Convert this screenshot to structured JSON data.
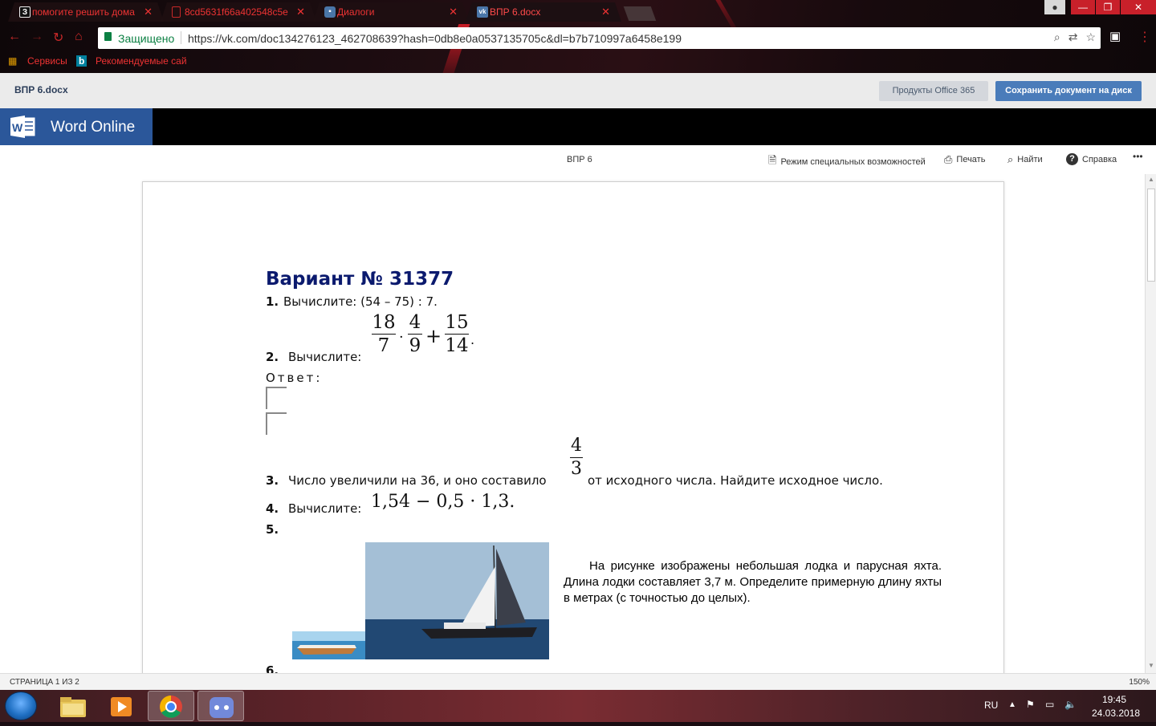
{
  "browser": {
    "tabs": [
      {
        "favicon": "З",
        "title": "помогите решить дома",
        "favicon_color": "#111111"
      },
      {
        "favicon": "pdf",
        "title": "8cd5631f66a402548c5e",
        "favicon_color": "#c62828"
      },
      {
        "favicon": "chat",
        "title": "Диалоги",
        "favicon_color": "#4a76a8"
      },
      {
        "favicon": "vk",
        "title": "ВПР 6.docx",
        "favicon_color": "#4a76a8"
      }
    ],
    "address": {
      "secure_label": "Защищено",
      "url": "https://vk.com/doc134276123_462708639?hash=0db8e0a0537135705c&dl=b7b710997a6458e199"
    },
    "bookmarks": [
      "Сервисы",
      "Рекомендуемые сай"
    ]
  },
  "office": {
    "file_name": "ВПР 6.docx",
    "products_button": "Продукты Office 365",
    "save_button": "Сохранить документ на диск",
    "app_name": "Word Online",
    "doc_title": "ВПР 6",
    "commands": {
      "accessibility": "Режим специальных возможностей",
      "print": "Печать",
      "find": "Найти",
      "help": "Справка",
      "more": "•••"
    }
  },
  "document": {
    "heading": "Вариант № 31377",
    "q1": {
      "num": "1.",
      "text": "Вычислите: (54 – 75) : 7."
    },
    "q2": {
      "num": "2.",
      "text": "Вычислите:",
      "frac1": {
        "n": "18",
        "d": "7"
      },
      "dot1": "·",
      "frac2": {
        "n": "4",
        "d": "9"
      },
      "plus": "+",
      "frac3": {
        "n": "15",
        "d": "14"
      },
      "end": "."
    },
    "answer_label": "Ответ:",
    "q3": {
      "num": "3.",
      "text_before": "Число увеличили на 36, и оно составило",
      "frac": {
        "n": "4",
        "d": "3"
      },
      "text_after": "от исходного числа. Найдите исходное число."
    },
    "q4": {
      "num": "4.",
      "text": "Вычислите:",
      "expr": "1,54 − 0,5 · 1,3."
    },
    "q5": {
      "num": "5.",
      "text": "На рисунке изображены небольшая лодка и парусная яхта. Длина лодки составляет 3,7 м. Определите примерную длину яхты в метрах (с точностью до целых)."
    },
    "q6": {
      "num": "6."
    }
  },
  "status": {
    "page": "СТРАНИЦА 1 ИЗ 2",
    "zoom": "150%"
  },
  "taskbar": {
    "lang": "RU",
    "time": "19:45",
    "date": "24.03.2018"
  }
}
